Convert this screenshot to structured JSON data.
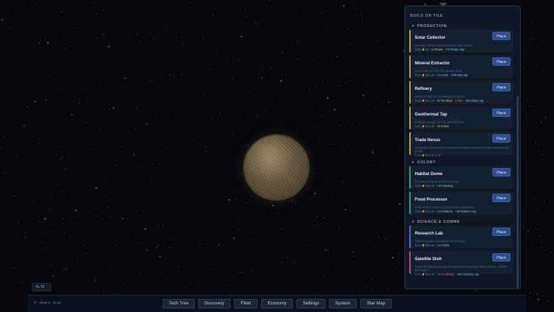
{
  "panel": {
    "title": "BUILD ON TILE",
    "sections": [
      {
        "name": "PRODUCTION",
        "cards": [
          {
            "name": "Solar Collector",
            "desc": "Harvests stellar energy to power your colony.",
            "cost": "Cost ⚡15",
            "effects": [
              {
                "t": "+2 Power",
                "c": "y"
              },
              {
                "t": "+75 Power cap",
                "c": "c"
              }
            ]
          },
          {
            "name": "Mineral Extractor",
            "desc": "Mines raw ore from the planet's crust.",
            "cost": "Cost ⚡15 ⬧ 10",
            "effects": [
              {
                "t": "+1.5 Ore",
                "c": "g"
              },
              {
                "t": "+100 Ore cap",
                "c": "c"
              }
            ]
          },
          {
            "name": "Refinery",
            "desc": "Converts raw ore into advanced alloys.",
            "cost": "Cost ⚡20 ⬧ 15",
            "effects": [
              {
                "t": "+0.75 Alloys",
                "c": "y"
              },
              {
                "t": "-1 Ore",
                "c": "r"
              },
              {
                "t": "+50 Alloys cap",
                "c": "c"
              }
            ]
          },
          {
            "name": "Geothermal Tap",
            "desc": "Extracts energy from the planet's core.",
            "cost": "Cost ⚡40 ⬧ 10",
            "effects": [
              {
                "t": "+5 Power",
                "c": "y"
              }
            ]
          },
          {
            "name": "Trade Nexus",
            "desc": "Generates income from markets and improves station trade routes for the planet.",
            "cost": "Cost ⚡20 ⬧ 20 ⬧ 15",
            "effects": []
          }
        ]
      },
      {
        "name": "COLONY",
        "cards": [
          {
            "name": "Habitat Dome",
            "desc": "Provides living space for colonists.",
            "cost": "Cost ⚡25 ⬧ 10",
            "effects": [
              {
                "t": "+10 Housing",
                "c": "c"
              }
            ]
          },
          {
            "name": "Food Processor",
            "desc": "Synthesizes rations to sustain your population.",
            "cost": "Cost ⚡20 ⬧ 10",
            "effects": [
              {
                "t": "+1.5 Rations",
                "c": "g"
              },
              {
                "t": "+30 Rations cap",
                "c": "c"
              }
            ]
          }
        ]
      },
      {
        "name": "SCIENCE & COMMS",
        "cards": [
          {
            "name": "Research Lab",
            "desc": "Advances your civilization's knowledge.",
            "cost": "Cost ⚡30 ⬧ 15",
            "effects": [
              {
                "t": "+1.5 Data",
                "c": "c"
              }
            ]
          },
          {
            "name": "Satellite Dish",
            "desc": "Scans for nearby planets and generates authority. More planets = faster discovery.",
            "cost": "Cost ⚡20 ⬧ 15",
            "effects": [
              {
                "t": "+0.5 Authority",
                "c": "p"
              },
              {
                "t": "+50 Authority cap",
                "c": "c"
              }
            ]
          }
        ]
      }
    ],
    "place_label": "Place"
  },
  "chip": {
    "label": "92"
  },
  "bottom": {
    "week_label": "Week 3 · 22 pts",
    "nav": [
      "Tech Tree",
      "Discovery",
      "Fleet",
      "Economy",
      "Settings",
      "System",
      "Star Map"
    ]
  }
}
